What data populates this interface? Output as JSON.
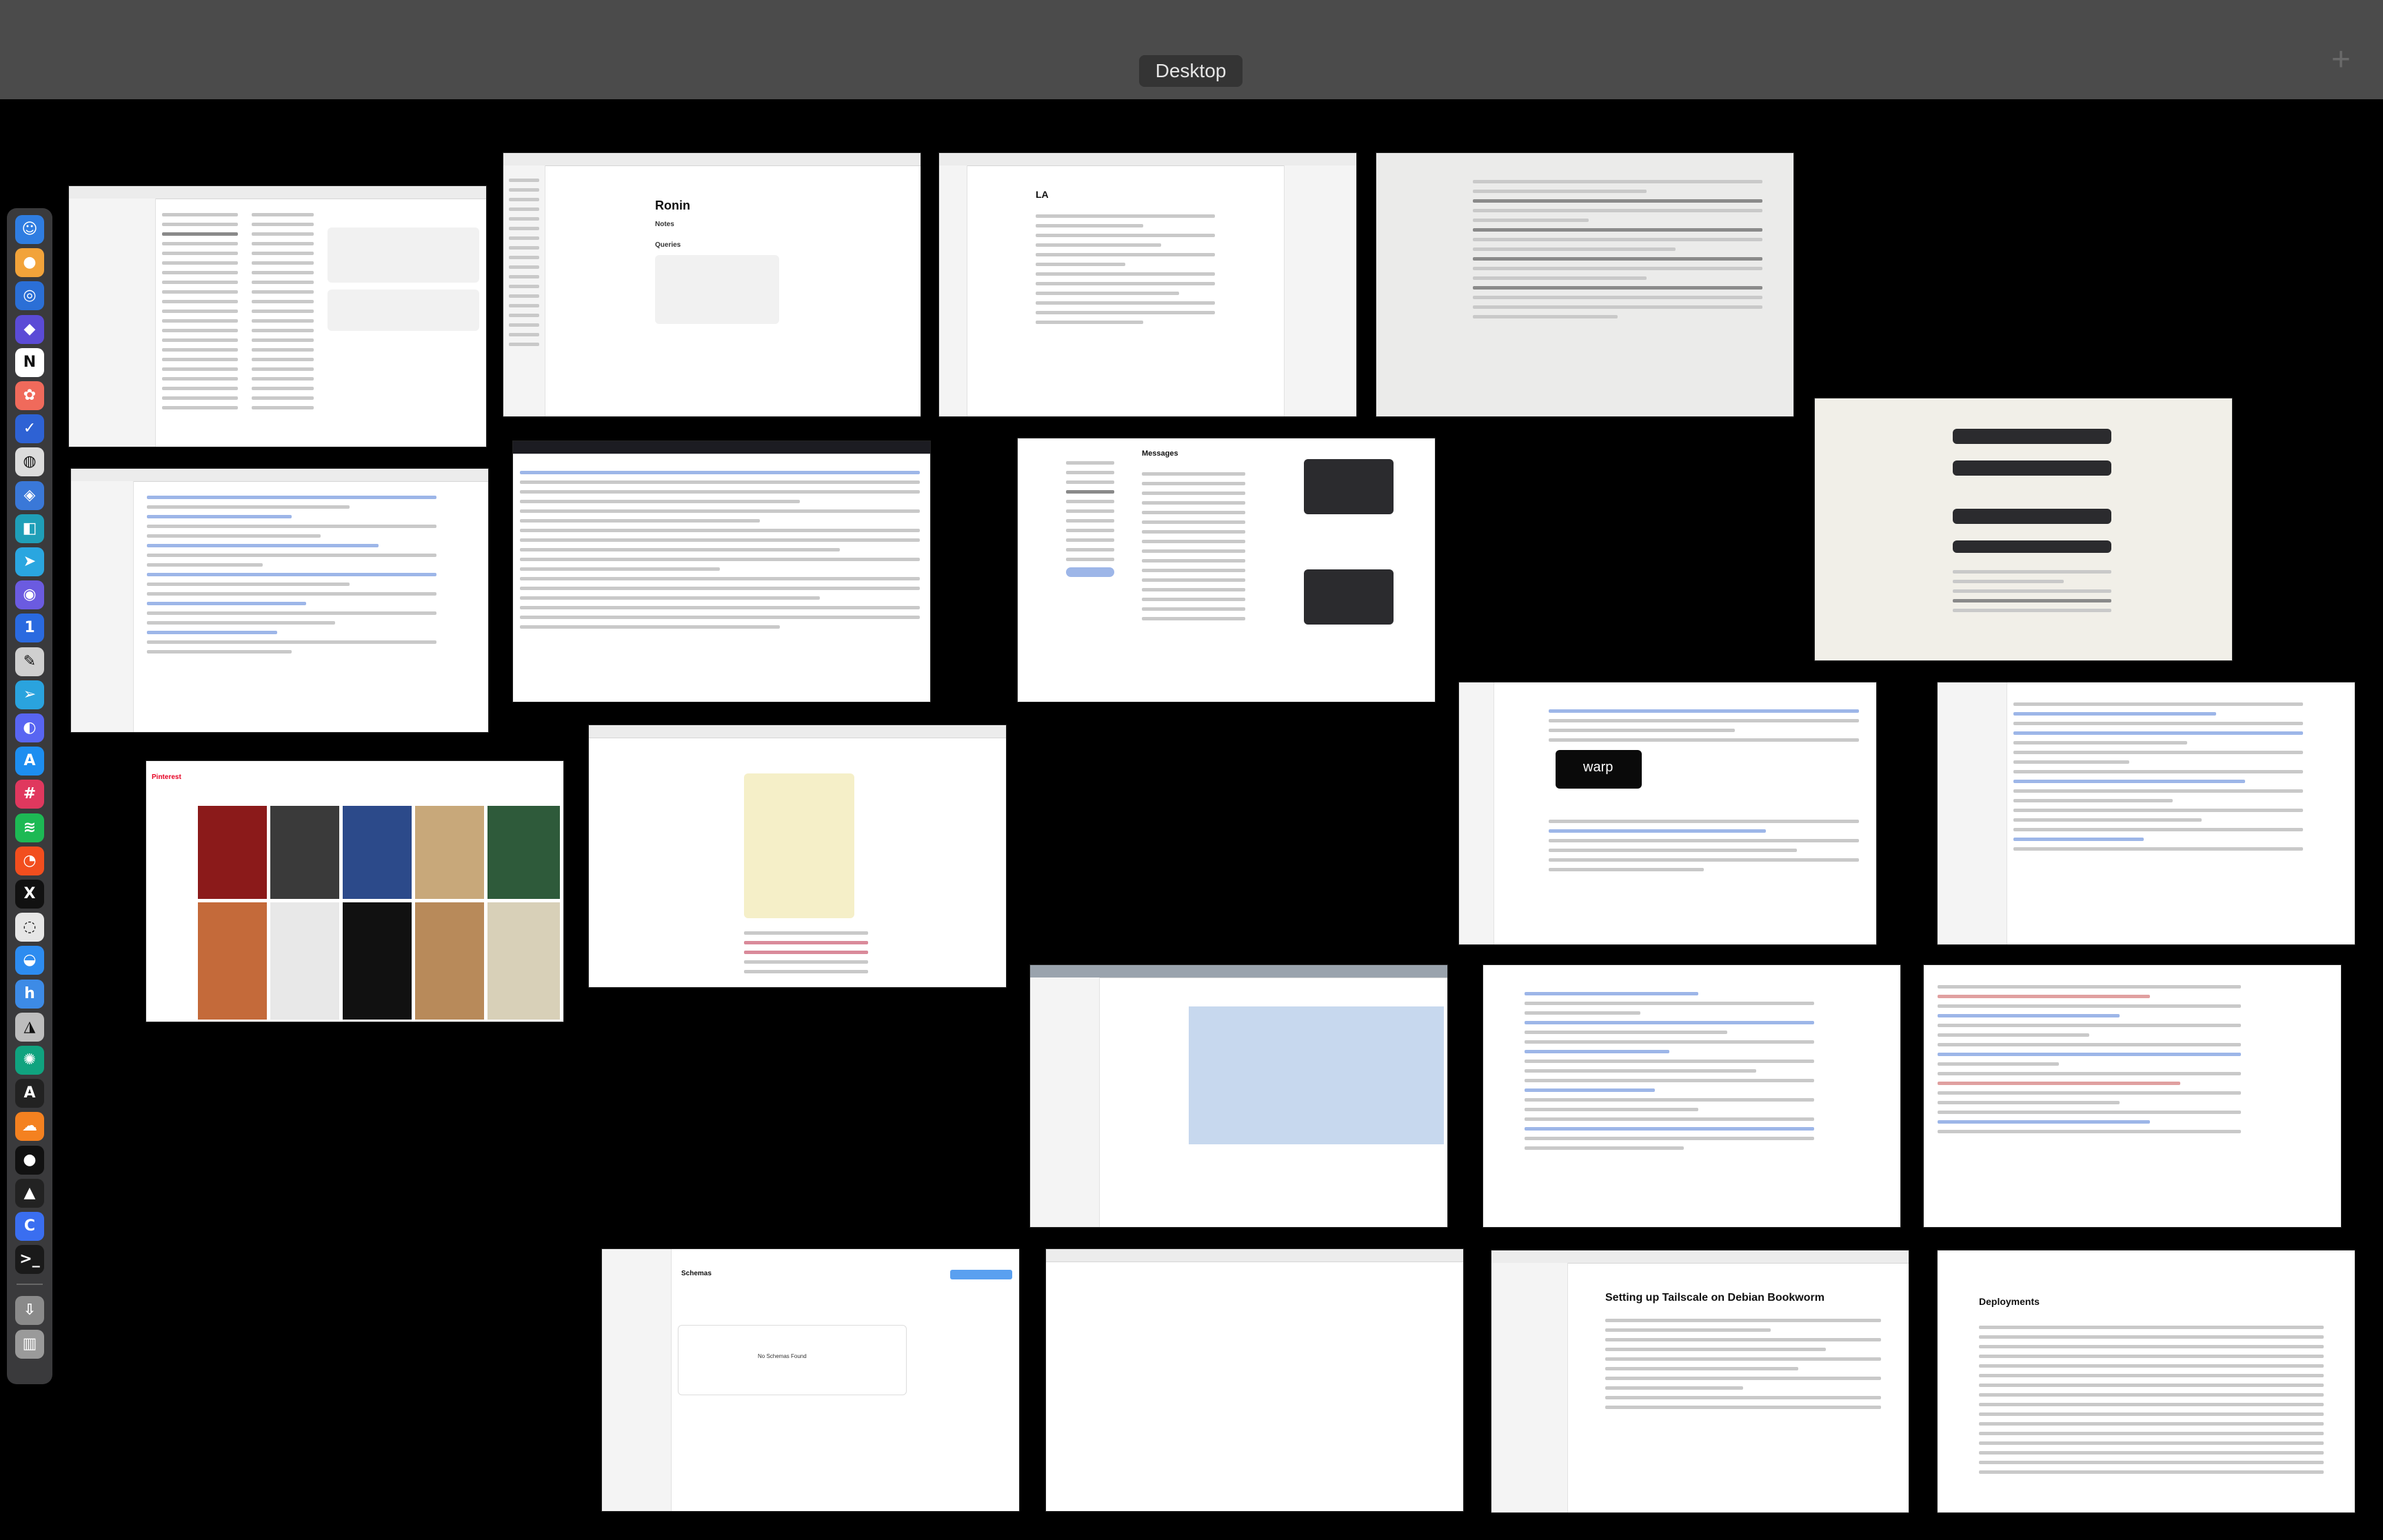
{
  "spaces_bar": {
    "space_label": "Desktop",
    "add_space_glyph": "+"
  },
  "dock": {
    "items": [
      {
        "name": "finder-icon",
        "glyph": "☺",
        "color": "#2f7de1"
      },
      {
        "name": "app-orange-icon",
        "glyph": "●",
        "color": "#f2a33a"
      },
      {
        "name": "safari-icon",
        "glyph": "◎",
        "color": "#2b6fd6"
      },
      {
        "name": "app-purple-icon",
        "glyph": "◆",
        "color": "#5b4bd6"
      },
      {
        "name": "notion-icon",
        "glyph": "N",
        "color": "#ffffff"
      },
      {
        "name": "photos-icon",
        "glyph": "✿",
        "color": "#f06a5b"
      },
      {
        "name": "tasks-icon",
        "glyph": "✓",
        "color": "#2e62d4"
      },
      {
        "name": "app-sphere-icon",
        "glyph": "◍",
        "color": "#dcdcdc"
      },
      {
        "name": "app-blue-icon",
        "glyph": "◈",
        "color": "#3a78d8"
      },
      {
        "name": "app-teal-icon",
        "glyph": "◧",
        "color": "#1f9fb8"
      },
      {
        "name": "send-icon",
        "glyph": "➤",
        "color": "#2aa6e0"
      },
      {
        "name": "app-violet-icon",
        "glyph": "◉",
        "color": "#6b5be0"
      },
      {
        "name": "1password-icon",
        "glyph": "1",
        "color": "#2a6ae0"
      },
      {
        "name": "pen-icon",
        "glyph": "✎",
        "color": "#cfcfcf"
      },
      {
        "name": "telegram-icon",
        "glyph": "➢",
        "color": "#2aa3de"
      },
      {
        "name": "discord-icon",
        "glyph": "◐",
        "color": "#5865f2"
      },
      {
        "name": "app-store-icon",
        "glyph": "A",
        "color": "#1d8ef0"
      },
      {
        "name": "slack-icon",
        "glyph": "#",
        "color": "#e0385e"
      },
      {
        "name": "spotify-icon",
        "glyph": "≋",
        "color": "#1db954"
      },
      {
        "name": "figma-icon",
        "glyph": "◔",
        "color": "#f24e1e"
      },
      {
        "name": "x-icon",
        "glyph": "X",
        "color": "#111111"
      },
      {
        "name": "app-white-icon",
        "glyph": "◌",
        "color": "#e6e6e6"
      },
      {
        "name": "edge-icon",
        "glyph": "◒",
        "color": "#2d8cf0"
      },
      {
        "name": "app-h-icon",
        "glyph": "h",
        "color": "#3d8be6"
      },
      {
        "name": "app-mono-icon",
        "glyph": "◮",
        "color": "#bdbdbd"
      },
      {
        "name": "chatgpt-icon",
        "glyph": "✺",
        "color": "#10a37f"
      },
      {
        "name": "app-a-icon",
        "glyph": "A",
        "color": "#222222"
      },
      {
        "name": "cloud-icon",
        "glyph": "☁",
        "color": "#f48120"
      },
      {
        "name": "app-black-icon",
        "glyph": "●",
        "color": "#111111"
      },
      {
        "name": "app-triangle-icon",
        "glyph": "▲",
        "color": "#222222"
      },
      {
        "name": "app-c-icon",
        "glyph": "C",
        "color": "#3a6ef0"
      },
      {
        "name": "terminal-icon",
        "glyph": ">_",
        "color": "#1a1a1a"
      },
      {
        "name": "downloads-icon",
        "glyph": "⇩",
        "color": "#8a8a8a"
      },
      {
        "name": "trash-icon",
        "glyph": "▥",
        "color": "#9a9a9a"
      }
    ]
  },
  "windows": {
    "ronin": {
      "title": "Ronin",
      "section1": "Notes",
      "section2": "Queries"
    },
    "li": {
      "title": "LA"
    },
    "messages": {
      "title": "Messages"
    },
    "warp_chat": {
      "banner": "warp"
    },
    "pinterest": {
      "title": "Pinterest"
    },
    "tailscale": {
      "title": "Setting up Tailscale on Debian Bookworm"
    },
    "deployments": {
      "title": "Deployments"
    },
    "schemas": {
      "title": "Schemas",
      "empty_text": "No Schemas Found"
    }
  }
}
